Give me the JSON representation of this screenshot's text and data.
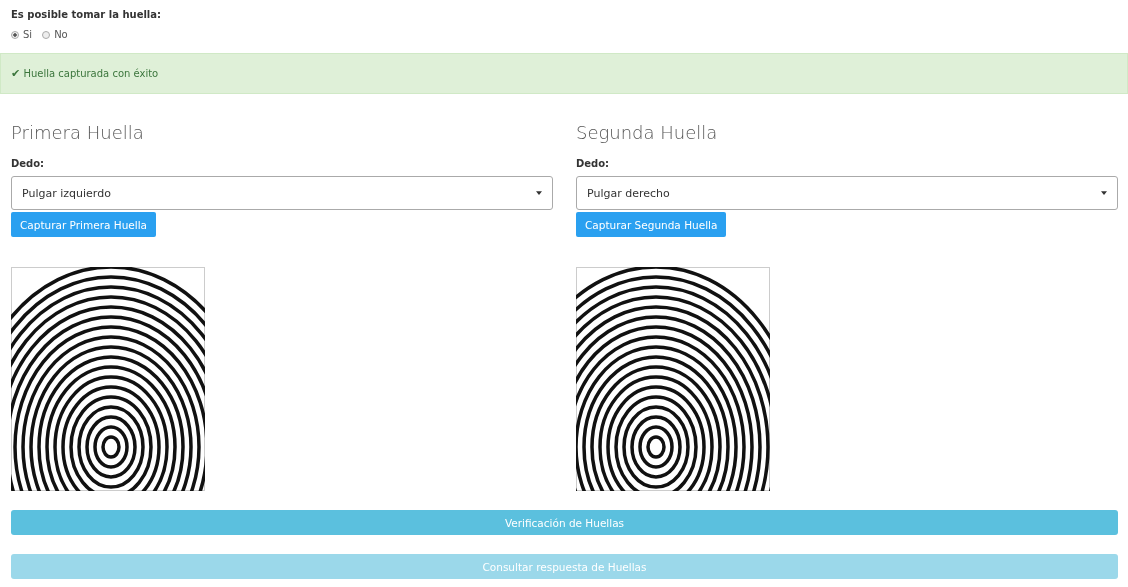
{
  "question": {
    "label": "Es posible tomar la huella:",
    "options": [
      {
        "label": "Si",
        "selected": true
      },
      {
        "label": "No",
        "selected": false
      }
    ]
  },
  "alert": {
    "icon": "✔",
    "text": "Huella capturada con éxito"
  },
  "panels": [
    {
      "title": "Primera Huella",
      "field_label": "Dedo:",
      "value": "Pulgar izquierdo",
      "button": "Capturar Primera Huella"
    },
    {
      "title": "Segunda Huella",
      "field_label": "Dedo:",
      "value": "Pulgar derecho",
      "button": "Capturar Segunda Huella"
    }
  ],
  "actions": [
    {
      "label": "Verificación de Huellas",
      "disabled": false
    },
    {
      "label": "Consultar respuesta de Huellas",
      "disabled": true
    }
  ]
}
